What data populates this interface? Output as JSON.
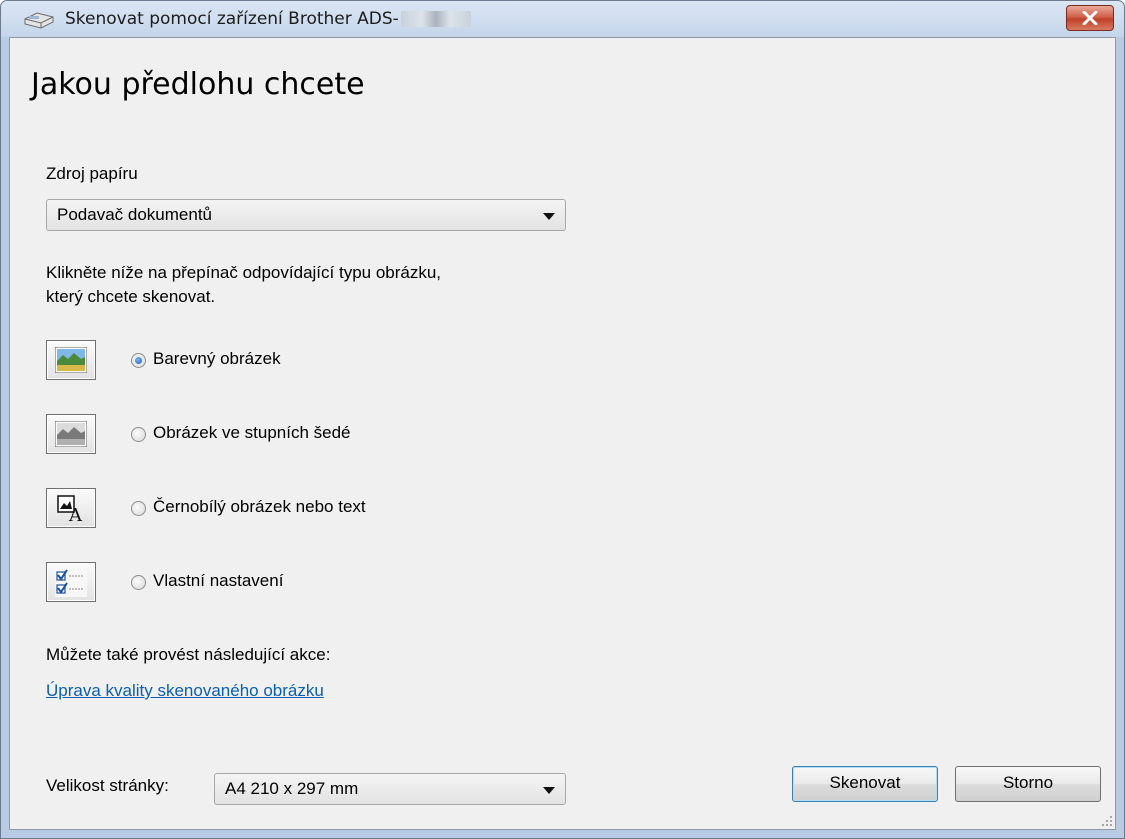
{
  "window": {
    "title": "Skenovat pomocí zařízení Brother ADS-"
  },
  "heading": "Jakou předlohu chcete",
  "paper_source": {
    "label": "Zdroj papíru",
    "value": "Podavač dokumentů"
  },
  "instruction_line1": "Klikněte níže na přepínač odpovídající typu obrázku,",
  "instruction_line2": "který chcete skenovat.",
  "image_types": [
    {
      "label": "Barevný obrázek",
      "selected": true,
      "icon": "color-picture-icon"
    },
    {
      "label": "Obrázek ve stupních šedé",
      "selected": false,
      "icon": "grayscale-picture-icon"
    },
    {
      "label": "Černobílý obrázek nebo text",
      "selected": false,
      "icon": "black-white-text-icon"
    },
    {
      "label": "Vlastní nastavení",
      "selected": false,
      "icon": "custom-settings-icon"
    }
  ],
  "also_actions_label": "Můžete také provést následující akce:",
  "adjust_link": "Úprava kvality skenovaného obrázku",
  "page_size": {
    "label": "Velikost stránky:",
    "value": "A4 210 x 297 mm"
  },
  "buttons": {
    "scan": "Skenovat",
    "cancel": "Storno"
  },
  "colors": {
    "link": "#0a5fb0",
    "close_button": "#c0412a"
  }
}
